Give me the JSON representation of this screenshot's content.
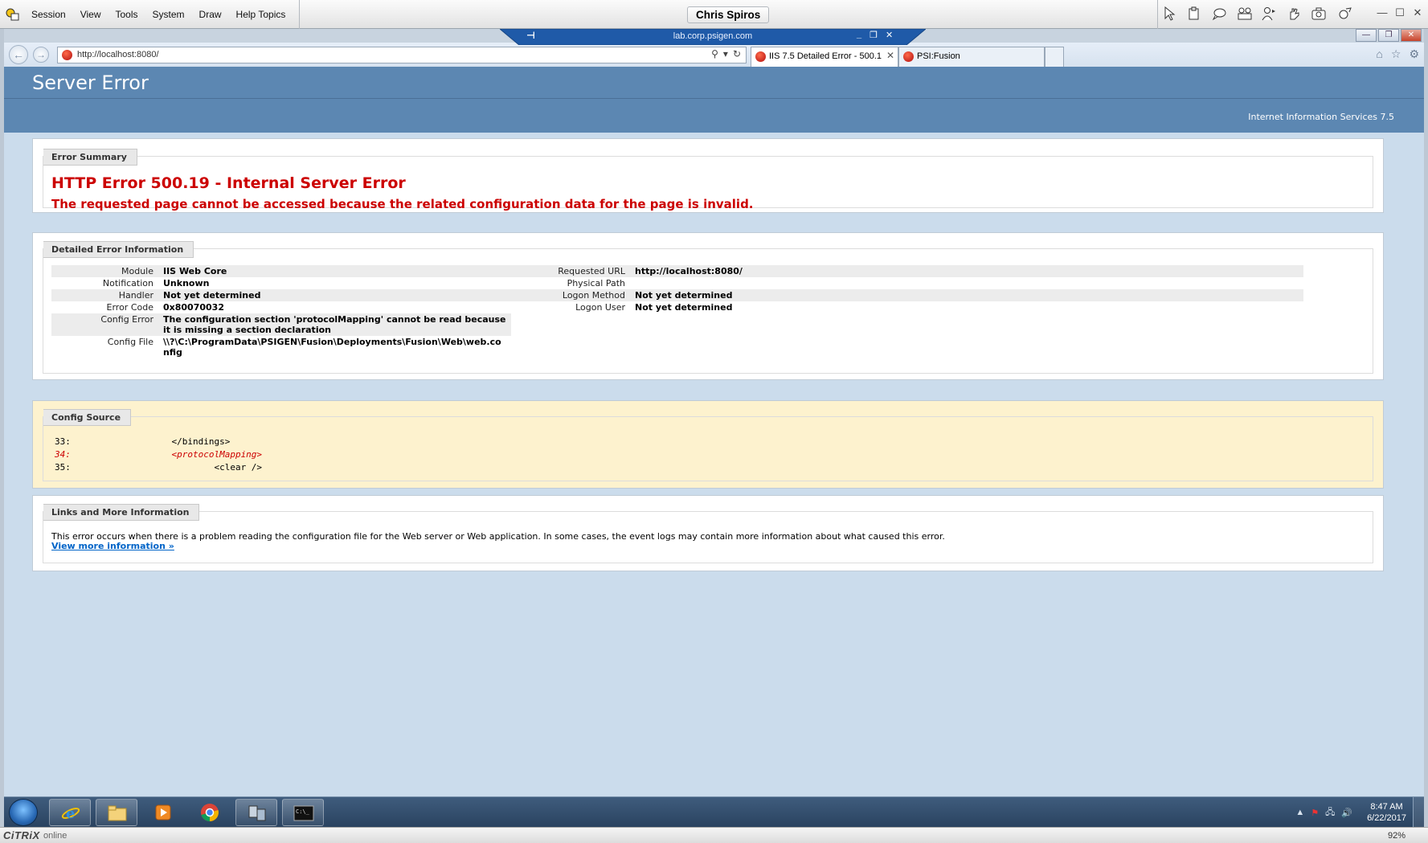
{
  "session": {
    "menu": [
      "Session",
      "View",
      "Tools",
      "System",
      "Draw",
      "Help Topics"
    ],
    "user": "Chris Spiros"
  },
  "connection": {
    "host": "lab.corp.psigen.com"
  },
  "browser": {
    "address": "http://localhost:8080/",
    "tabs": [
      {
        "title": "IIS 7.5 Detailed Error - 500.1..."
      },
      {
        "title": "PSI:Fusion"
      }
    ]
  },
  "page": {
    "header": "Server Error",
    "server_name": "Internet Information Services 7.5",
    "summary": {
      "legend": "Error Summary",
      "title": "HTTP Error 500.19 - Internal Server Error",
      "subtitle": "The requested page cannot be accessed because the related configuration data for the page is invalid."
    },
    "details": {
      "legend": "Detailed Error Information",
      "left": [
        {
          "label": "Module",
          "value": "IIS Web Core"
        },
        {
          "label": "Notification",
          "value": "Unknown"
        },
        {
          "label": "Handler",
          "value": "Not yet determined"
        },
        {
          "label": "Error Code",
          "value": "0x80070032"
        },
        {
          "label": "Config Error",
          "value": "The configuration section 'protocolMapping' cannot be read because it is missing a section declaration"
        },
        {
          "label": "Config File",
          "value": "\\\\?\\C:\\ProgramData\\PSIGEN\\Fusion\\Deployments\\Fusion\\Web\\web.config"
        }
      ],
      "right": [
        {
          "label": "Requested URL",
          "value": "http://localhost:8080/"
        },
        {
          "label": "Physical Path",
          "value": ""
        },
        {
          "label": "Logon Method",
          "value": "Not yet determined"
        },
        {
          "label": "Logon User",
          "value": "Not yet determined"
        }
      ]
    },
    "config_source": {
      "legend": "Config Source",
      "lines": [
        {
          "num": "33:",
          "code": "            </bindings>"
        },
        {
          "num": "34:",
          "code": "            <protocolMapping>"
        },
        {
          "num": "35:",
          "code": "                    <clear />"
        }
      ]
    },
    "links": {
      "legend": "Links and More Information",
      "text": "This error occurs when there is a problem reading the configuration file for the Web server or Web application. In some cases, the event logs may contain more information about what caused this error.",
      "more": "View more information »"
    }
  },
  "taskbar": {
    "time": "8:47 AM",
    "date": "6/22/2017"
  },
  "statusbar": {
    "brand": "CiTRiX",
    "status": "online",
    "zoom": "92%"
  },
  "colors": {
    "header_blue": "#5c87b2",
    "error_red": "#cc0000",
    "config_yellow": "#fdf2ce",
    "link_blue": "#0064c8"
  }
}
